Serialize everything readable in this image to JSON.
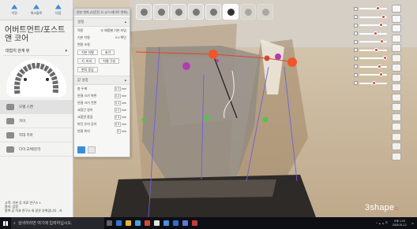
{
  "left_panel": {
    "nav": [
      "이전",
      "워크플로",
      "다음"
    ],
    "title": "어버트먼트/포스트 앤 코어",
    "subhead": "대합치 관계 뷰",
    "list_items": [
      "모델 스캔",
      "치아",
      "지대 치아",
      "다이 교체/분리"
    ],
    "footer": [
      "고객: 기본 공 치료 연구소 1",
      "환자: 김원",
      "팔복 공 치과 연구소 와 같은 부위입니다 . 서"
    ]
  },
  "settings_panel": {
    "header": "원본 변화 (마운틴 오 교 드레이트 변화)",
    "section_title": "설정",
    "preset_label": "적용",
    "preset_value": "① 제품별 기본 타입",
    "spacing_label": "기본 치형",
    "spacing_value": "0.0 확인",
    "apply_label": "변환 조절",
    "buttons_a": [
      "기본 치형",
      "초기"
    ],
    "buttons_b": [
      "기, 미리",
      "치형 구성"
    ],
    "model_label": "변치 증상",
    "params_title": "값 설정",
    "params": [
      {
        "label": "총 두께",
        "value": "0.3"
      },
      {
        "label": "연결 크기 측면",
        "value": "0.4"
      },
      {
        "label": "연결 크기 전면",
        "value": "0.4"
      },
      {
        "label": "교합간 길이",
        "value": "2.0"
      },
      {
        "label": "교합면 흠집",
        "value": "0.3"
      },
      {
        "label": "마진 유지 길이",
        "value": "0.5"
      },
      {
        "label": "연결 위치",
        "value": "0"
      }
    ],
    "unit": "mm"
  },
  "logo": {
    "text": "3shape"
  },
  "taskbar": {
    "search_placeholder": "검색하려면 여기에 입력하십시오.",
    "lang": "가",
    "time": "오후 1:23",
    "date": "2018-01-12"
  },
  "colors": {
    "accent": "#3a8dd8",
    "taskbar": "#0d0f14",
    "marker_orange": "#f0562a",
    "marker_green": "#55c24d",
    "marker_magenta": "#b23bb0",
    "spline_red": "#e0442f",
    "guide_purple": "#6f5fd8"
  },
  "icons": {
    "toolbar": [
      "view-icon",
      "rotate-icon",
      "tooth-icon",
      "sculpt-icon",
      "tooth-select-icon",
      "arch-icon",
      "grid-icon",
      "close-icon"
    ]
  }
}
